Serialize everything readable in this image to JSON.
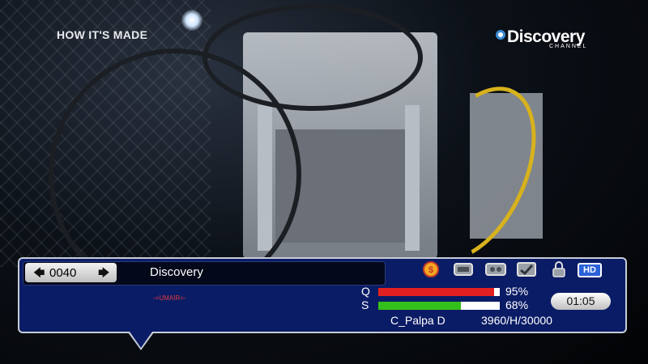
{
  "overlay": {
    "show_title": "HOW IT'S MADE",
    "logo_name": "Discovery",
    "logo_sub": "CHANNEL"
  },
  "infobar": {
    "channel_number": "0040",
    "channel_name": "Discovery",
    "tag": "-=UMAIR=-",
    "icons": [
      "coin-icon",
      "epg-icon",
      "subtitle-icon",
      "teletext-icon",
      "lock-icon",
      "hd-icon"
    ],
    "hd_label": "HD",
    "quality": {
      "label": "Q",
      "percent_text": "95%",
      "value": 95,
      "color": "#e32020"
    },
    "strength": {
      "label": "S",
      "percent_text": "68%",
      "value": 68,
      "color": "#34c01a"
    },
    "time": "01:05",
    "satellite": "C_Palpa D",
    "transponder": "3960/H/30000"
  }
}
